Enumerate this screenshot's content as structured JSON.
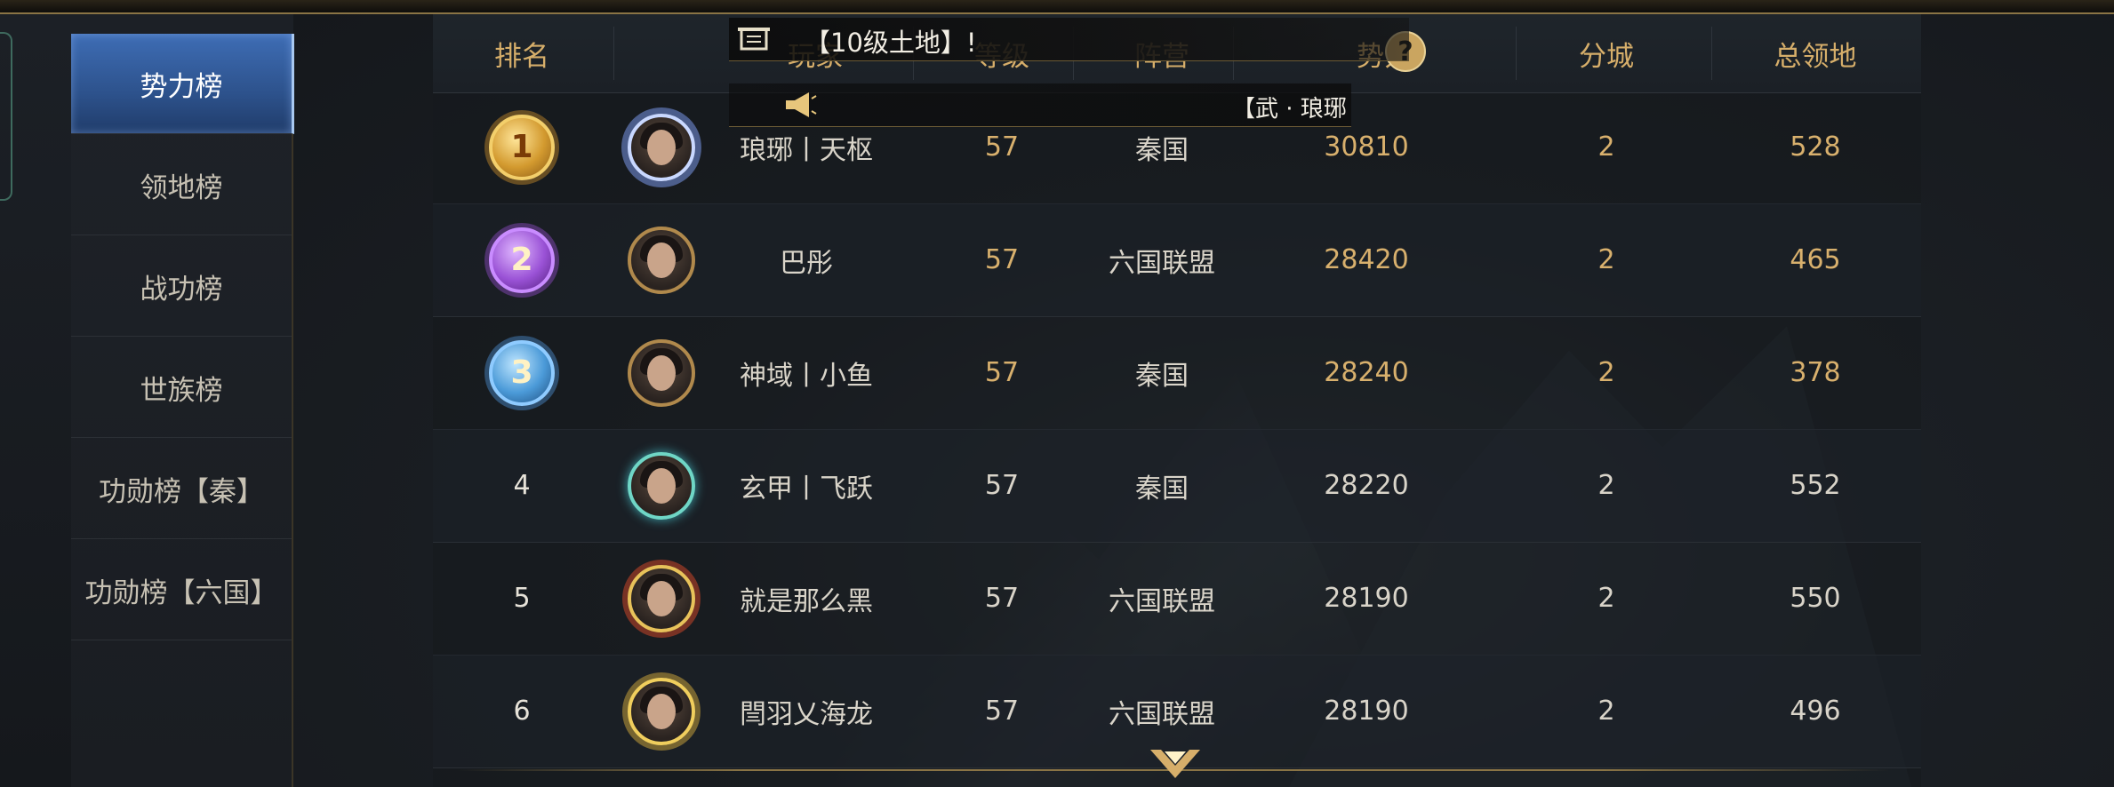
{
  "sidebar": {
    "items": [
      {
        "label": "势力榜",
        "active": true
      },
      {
        "label": "领地榜",
        "active": false
      },
      {
        "label": "战功榜",
        "active": false
      },
      {
        "label": "世族榜",
        "active": false
      },
      {
        "label": "功勋榜【秦】",
        "active": false
      },
      {
        "label": "功勋榜【六国】",
        "active": false
      }
    ]
  },
  "table": {
    "headers": {
      "rank": "排名",
      "player": "玩家",
      "level": "等级",
      "faction": "阵营",
      "power": "势力",
      "branch_cities": "分城",
      "total_territory": "总领地"
    },
    "rows": [
      {
        "rank": "1",
        "name": "琅琊丨天枢",
        "level": "57",
        "faction": "秦国",
        "power": "30810",
        "branch": "2",
        "territory": "528"
      },
      {
        "rank": "2",
        "name": "巴彤",
        "level": "57",
        "faction": "六国联盟",
        "power": "28420",
        "branch": "2",
        "territory": "465"
      },
      {
        "rank": "3",
        "name": "神域丨小鱼",
        "level": "57",
        "faction": "秦国",
        "power": "28240",
        "branch": "2",
        "territory": "378"
      },
      {
        "rank": "4",
        "name": "玄甲丨飞跃",
        "level": "57",
        "faction": "秦国",
        "power": "28220",
        "branch": "2",
        "territory": "552"
      },
      {
        "rank": "5",
        "name": "就是那么黑",
        "level": "57",
        "faction": "六国联盟",
        "power": "28190",
        "branch": "2",
        "territory": "550"
      },
      {
        "rank": "6",
        "name": "閆羽乂海龙",
        "level": "57",
        "faction": "六国联盟",
        "power": "28190",
        "branch": "2",
        "territory": "496"
      }
    ]
  },
  "notice": {
    "text": "【10级土地】!",
    "secondary_text": "【武 · 琅琊"
  },
  "help_label": "?",
  "icons": {
    "notice": "scroll-icon",
    "horn": "horn-icon",
    "help": "help-icon",
    "scroll_down": "chevron-down-icon"
  },
  "colors": {
    "accent_gold": "#d6ae6a",
    "active_tab": "#3e6db5"
  }
}
